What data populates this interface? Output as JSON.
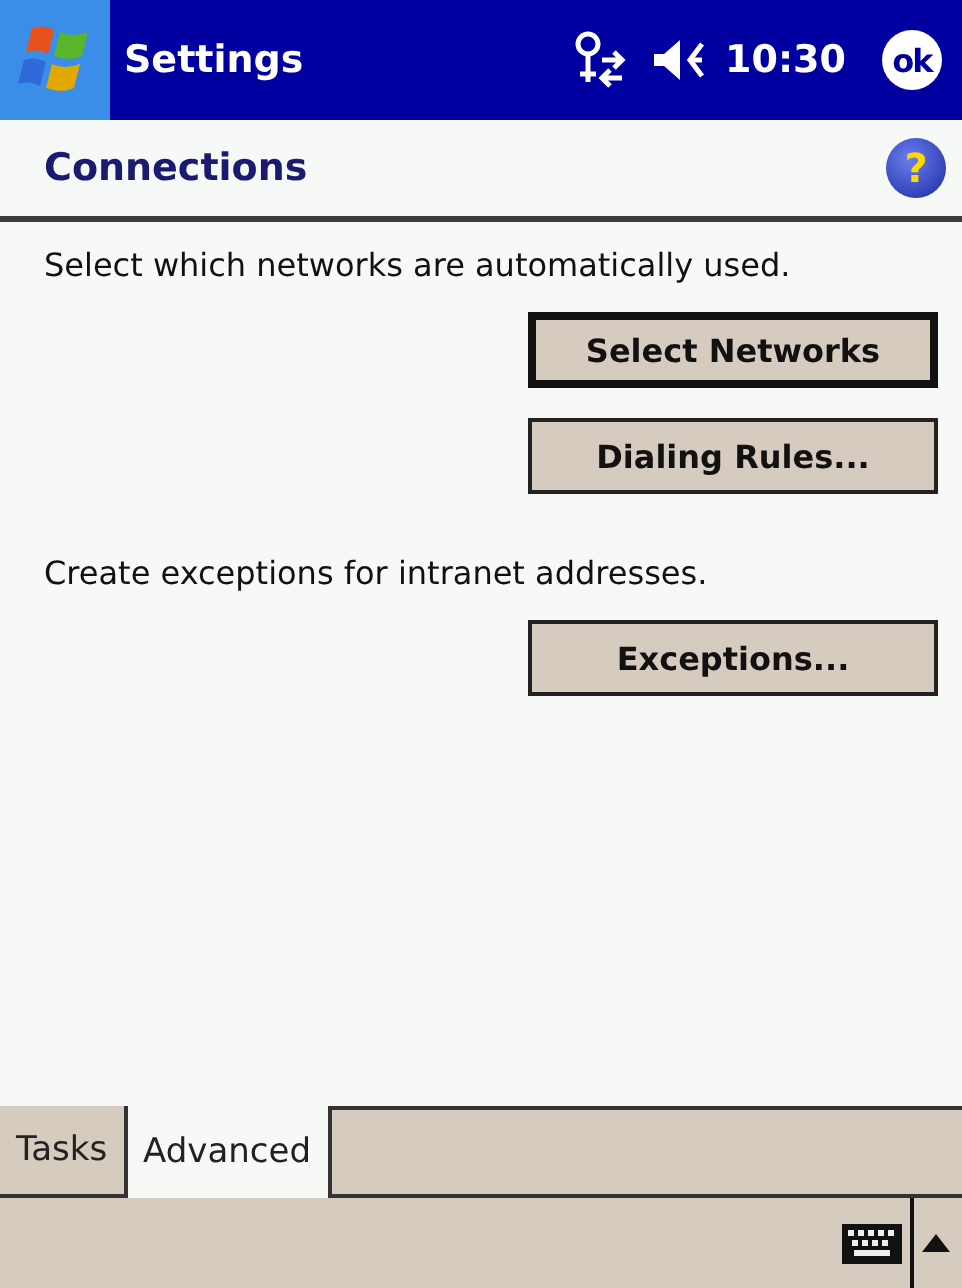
{
  "title_bar": {
    "title": "Settings",
    "time": "10:30",
    "ok": "ok"
  },
  "header": {
    "title": "Connections",
    "help": "?"
  },
  "sections": [
    {
      "text": "Select which networks are automatically used.",
      "buttons": [
        {
          "label": "Select Networks",
          "default": true
        },
        {
          "label": "Dialing Rules...",
          "default": false
        }
      ]
    },
    {
      "text": "Create exceptions for intranet addresses.",
      "buttons": [
        {
          "label": "Exceptions...",
          "default": false
        }
      ]
    }
  ],
  "tabs": [
    {
      "label": "Tasks",
      "selected": false
    },
    {
      "label": "Advanced",
      "selected": true
    }
  ]
}
